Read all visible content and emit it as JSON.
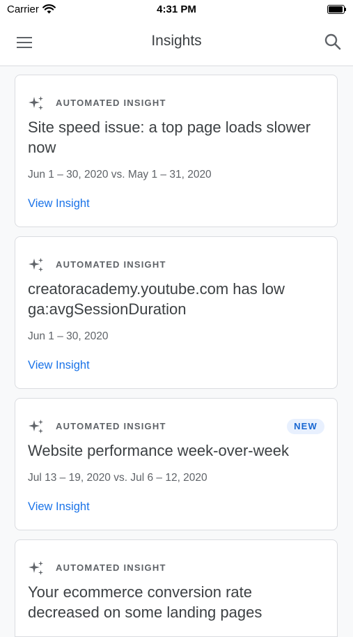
{
  "status_bar": {
    "carrier": "Carrier",
    "time": "4:31 PM"
  },
  "app_bar": {
    "title": "Insights",
    "menu_icon": "menu-icon",
    "search_icon": "search-icon"
  },
  "insights": [
    {
      "label": "AUTOMATED INSIGHT",
      "title": "Site speed issue: a top page loads slower now",
      "date": "Jun 1 – 30, 2020 vs. May 1 – 31, 2020",
      "action": "View Insight"
    },
    {
      "label": "AUTOMATED INSIGHT",
      "title": "creatoracademy.youtube.com has low ga:avgSessionDuration",
      "date": "Jun 1 – 30, 2020",
      "action": "View Insight"
    },
    {
      "label": "AUTOMATED INSIGHT",
      "badge": "NEW",
      "title": "Website performance week-over-week",
      "date": "Jul 13 – 19, 2020 vs. Jul 6 – 12, 2020",
      "action": "View Insight"
    },
    {
      "label": "AUTOMATED INSIGHT",
      "title": "Your ecommerce conversion rate decreased on some landing pages"
    }
  ],
  "colors": {
    "accent": "#1a73e8",
    "badge_bg": "#e8f0fe",
    "text_primary": "#3c4043",
    "text_secondary": "#5f6368"
  }
}
